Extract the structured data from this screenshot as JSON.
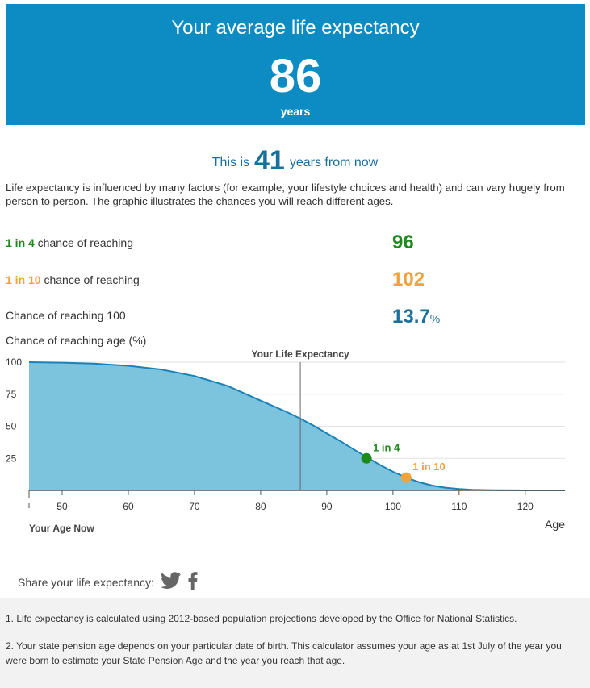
{
  "banner": {
    "title": "Your average life expectancy",
    "value": "86",
    "unit": "years"
  },
  "from_now": {
    "prefix": "This is",
    "value": "41",
    "suffix": "years from now"
  },
  "intro": "Life expectancy is influenced by many factors (for example, your lifestyle choices and health) and can vary hugely from person to person. The graphic illustrates the chances you will reach different ages.",
  "stats": {
    "one_in_four": {
      "highlight": "1 in 4",
      "label": " chance of reaching",
      "value": "96",
      "color": "#1e8a1e"
    },
    "one_in_ten": {
      "highlight": "1 in 10",
      "label": " chance of reaching",
      "value": "102",
      "color": "#f0a23c"
    },
    "hundred": {
      "label": "Chance of reaching 100",
      "value": "13.7",
      "unit": "%",
      "color": "#1a6f9c"
    }
  },
  "chart_data": {
    "type": "area",
    "title": "Chance of reaching age (%)",
    "xlabel": "Age",
    "ylabel": "",
    "x_ticks": [
      50,
      60,
      70,
      80,
      90,
      100,
      110,
      120
    ],
    "y_ticks": [
      25,
      50,
      75,
      100
    ],
    "xlim": [
      45,
      126
    ],
    "ylim": [
      0,
      100
    ],
    "series": [
      {
        "x": [
          45,
          50,
          55,
          60,
          65,
          70,
          75,
          80,
          84,
          86,
          88,
          90,
          92,
          94,
          96,
          98,
          100,
          102,
          104,
          106,
          108,
          110,
          112,
          115,
          120,
          126
        ],
        "y": [
          100,
          99.6,
          98.8,
          97.2,
          94.3,
          89.2,
          81.5,
          70,
          61,
          56,
          50.5,
          44.5,
          38.5,
          32.2,
          26,
          20,
          14.5,
          10,
          6.3,
          3.7,
          2.1,
          1.1,
          0.5,
          0.1,
          0,
          0
        ]
      }
    ],
    "vertical_marker": {
      "x": 86,
      "label": "Your Life Expectancy"
    },
    "start_label": "Your Age Now",
    "points": [
      {
        "x": 96,
        "y": 25,
        "label": "1 in 4",
        "color": "#1e8a1e"
      },
      {
        "x": 102,
        "y": 10,
        "label": "1 in 10",
        "color": "#f0a23c"
      }
    ],
    "grid": true,
    "colors": {
      "line": "#1a82b8",
      "fill": "#7cc4de"
    }
  },
  "share": {
    "label": "Share your life expectancy:",
    "twitter_icon": "twitter-icon",
    "facebook_icon": "facebook-icon"
  },
  "footnotes": [
    "1. Life expectancy is calculated using 2012-based population projections developed by the Office for National Statistics.",
    "2. Your state pension age depends on your particular date of birth. This calculator assumes your age as at 1st July of the year you were born to estimate your State Pension Age and the year you reach that age."
  ]
}
